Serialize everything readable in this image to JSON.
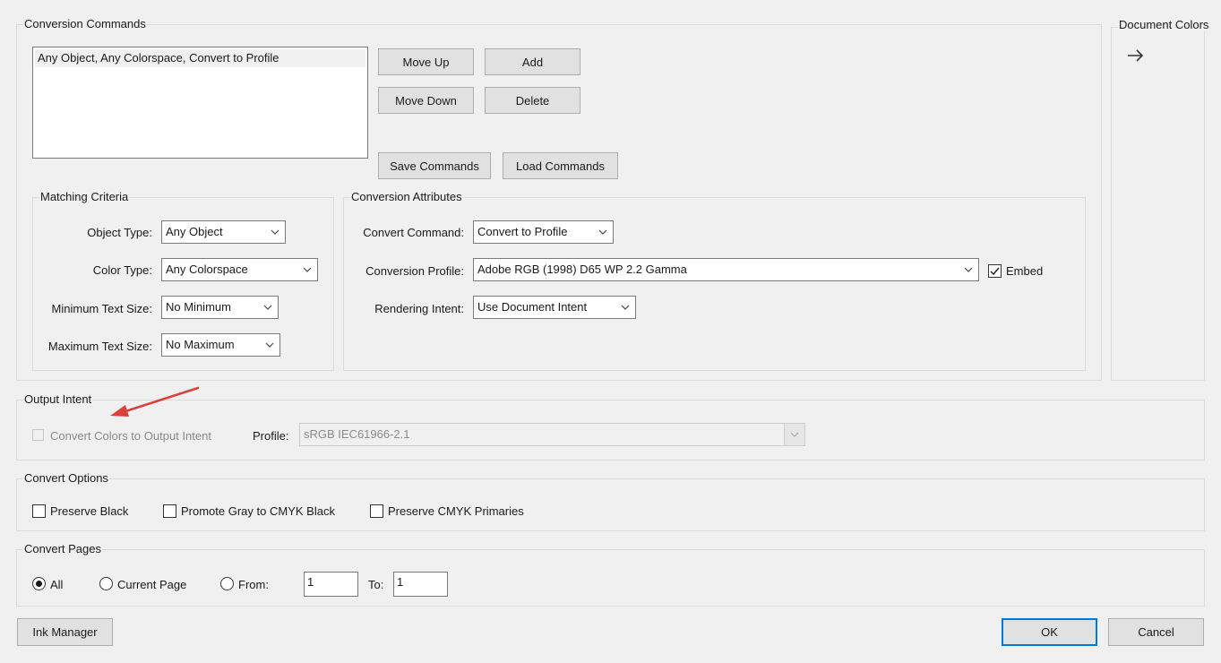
{
  "conversion_commands": {
    "title": "Conversion Commands",
    "list_items": [
      "Any Object, Any Colorspace, Convert to Profile"
    ],
    "move_up": "Move Up",
    "add": "Add",
    "move_down": "Move Down",
    "delete": "Delete",
    "save_commands": "Save Commands",
    "load_commands": "Load Commands"
  },
  "document_colors": {
    "title": "Document Colors",
    "arrow_icon": "arrow-right-icon"
  },
  "matching_criteria": {
    "title": "Matching Criteria",
    "object_type_label": "Object Type:",
    "object_type_value": "Any Object",
    "color_type_label": "Color Type:",
    "color_type_value": "Any Colorspace",
    "min_text_label": "Minimum Text Size:",
    "min_text_value": "No Minimum",
    "max_text_label": "Maximum Text Size:",
    "max_text_value": "No Maximum"
  },
  "conversion_attributes": {
    "title": "Conversion Attributes",
    "convert_command_label": "Convert Command:",
    "convert_command_value": "Convert to Profile",
    "conversion_profile_label": "Conversion Profile:",
    "conversion_profile_value": "Adobe RGB (1998) D65 WP 2.2 Gamma",
    "embed_label": "Embed",
    "embed_checked": true,
    "rendering_intent_label": "Rendering Intent:",
    "rendering_intent_value": "Use Document Intent"
  },
  "output_intent": {
    "title": "Output Intent",
    "convert_colors_label": "Convert Colors to Output Intent",
    "convert_colors_checked": false,
    "convert_colors_enabled": false,
    "profile_label": "Profile:",
    "profile_value": "sRGB IEC61966-2.1",
    "annotation_color": "#d9423a"
  },
  "convert_options": {
    "title": "Convert Options",
    "preserve_black": "Preserve Black",
    "promote_gray": "Promote Gray to CMYK Black",
    "preserve_cmyk": "Preserve CMYK Primaries"
  },
  "convert_pages": {
    "title": "Convert Pages",
    "all": "All",
    "current_page": "Current Page",
    "from": "From:",
    "from_value": "1",
    "to": "To:",
    "to_value": "1",
    "selected": "All"
  },
  "footer": {
    "ink_manager": "Ink Manager",
    "ok": "OK",
    "cancel": "Cancel"
  },
  "colors": {
    "accent": "#0078d7",
    "annotation": "#d9423a"
  }
}
